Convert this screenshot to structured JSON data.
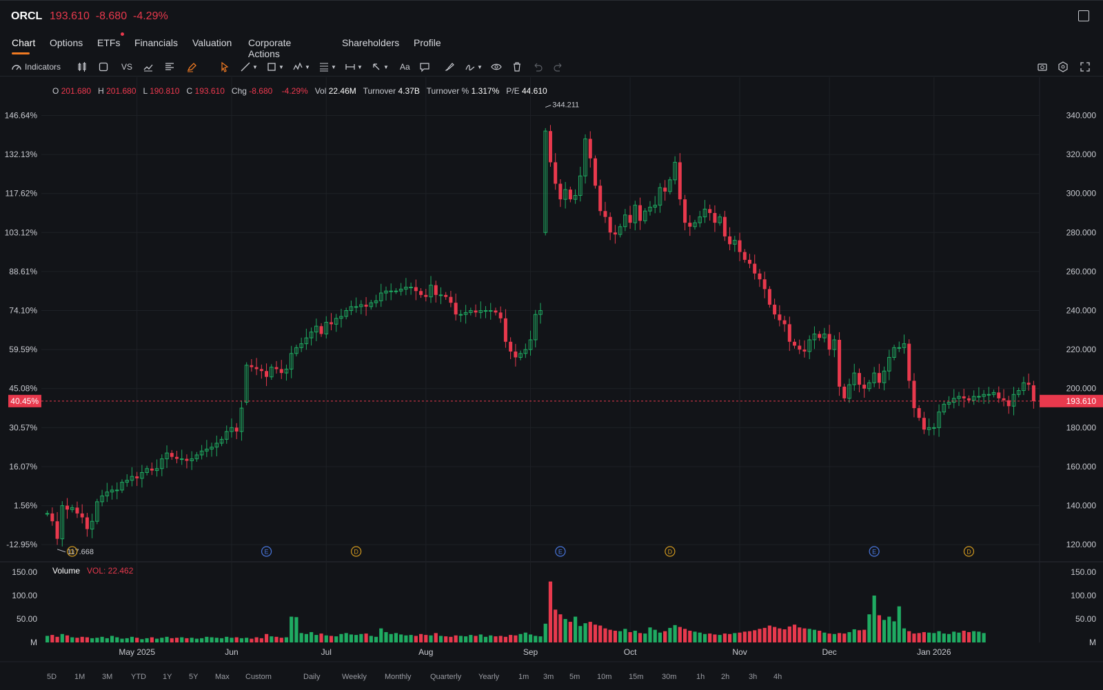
{
  "header": {
    "symbol": "ORCL",
    "price": "193.610",
    "change": "-8.680",
    "change_pct": "-4.29%"
  },
  "tabs": [
    "Chart",
    "Options",
    "ETFs",
    "Financials",
    "Valuation",
    "Corporate Actions",
    "Shareholders",
    "Profile"
  ],
  "toolbar": {
    "indicators_label": "Indicators",
    "vs_label": "VS",
    "text_label": "Aa"
  },
  "ohlc": {
    "o_label": "O",
    "o": "201.680",
    "h_label": "H",
    "h": "201.680",
    "l_label": "L",
    "l": "190.810",
    "c_label": "C",
    "c": "193.610",
    "chg_label": "Chg",
    "chg": "-8.680",
    "chg_pct": "-4.29%",
    "vol_label": "Vol",
    "vol": "22.46M",
    "turnover_label": "Turnover",
    "turnover": "4.37B",
    "turnover_pct_label": "Turnover %",
    "turnover_pct": "1.317%",
    "pe_label": "P/E",
    "pe": "44.610"
  },
  "colors": {
    "up": "#1fab62",
    "down": "#e8394d",
    "accent": "#f07a22"
  },
  "chart_data": {
    "type": "candlestick",
    "price_axis_labels": [
      "340.000",
      "320.000",
      "300.000",
      "280.000",
      "260.000",
      "240.000",
      "220.000",
      "200.000",
      "180.000",
      "160.000",
      "140.000",
      "120.000"
    ],
    "price_axis_values": [
      340,
      320,
      300,
      280,
      260,
      240,
      220,
      200,
      180,
      160,
      140,
      120
    ],
    "pct_axis_labels": [
      "146.64%",
      "132.13%",
      "117.62%",
      "103.12%",
      "88.61%",
      "74.10%",
      "59.59%",
      "45.08%",
      "30.57%",
      "16.07%",
      "1.56%",
      "-12.95%"
    ],
    "ylim": [
      113,
      349
    ],
    "current_price_label": "193.610",
    "current_pct_label": "40.45%",
    "current_price": 193.61,
    "max_label": "344.211",
    "max_value": 344.211,
    "min_label": "117.668",
    "min_value": 117.668,
    "x_labels": [
      "May 2025",
      "Jun",
      "Jul",
      "Aug",
      "Sep",
      "Oct",
      "Nov",
      "Dec",
      "Jan 2026"
    ],
    "x_label_index": [
      18,
      37,
      56,
      76,
      97,
      117,
      139,
      157,
      178
    ],
    "event_markers": [
      {
        "label": "D",
        "index": 5,
        "kind": "dividend"
      },
      {
        "label": "E",
        "index": 44,
        "kind": "earnings"
      },
      {
        "label": "D",
        "index": 62,
        "kind": "dividend"
      },
      {
        "label": "E",
        "index": 103,
        "kind": "earnings"
      },
      {
        "label": "D",
        "index": 125,
        "kind": "dividend"
      },
      {
        "label": "E",
        "index": 166,
        "kind": "earnings"
      },
      {
        "label": "D",
        "index": 185,
        "kind": "dividend"
      }
    ],
    "closes": [
      136,
      132,
      123,
      140,
      138,
      139,
      136,
      134,
      128,
      132,
      142,
      145,
      147,
      148,
      148,
      152,
      153,
      155,
      154,
      157,
      159,
      158,
      159,
      164,
      167,
      165,
      164,
      164,
      163,
      164,
      166,
      168,
      169,
      170,
      172,
      174,
      178,
      180,
      178,
      190,
      212,
      211,
      210,
      209,
      206,
      211,
      210,
      208,
      210,
      218,
      221,
      223,
      226,
      229,
      232,
      228,
      234,
      233,
      236,
      237,
      240,
      242,
      242,
      243,
      242,
      244,
      245,
      249,
      250,
      250,
      250,
      251,
      252,
      252,
      250,
      248,
      247,
      253,
      248,
      248,
      247,
      244,
      238,
      238,
      239,
      240,
      239,
      240,
      240,
      240,
      239,
      236,
      224,
      219,
      216,
      218,
      220,
      225,
      238,
      240,
      332,
      316,
      305,
      297,
      302,
      297,
      299,
      309,
      328,
      318,
      304,
      291,
      288,
      280,
      279,
      283,
      289,
      285,
      294,
      286,
      291,
      293,
      294,
      303,
      301,
      307,
      316,
      297,
      285,
      283,
      285,
      288,
      292,
      290,
      285,
      288,
      278,
      274,
      276,
      270,
      266,
      264,
      259,
      256,
      251,
      243,
      238,
      235,
      233,
      224,
      222,
      220,
      219,
      225,
      228,
      226,
      228,
      220,
      225,
      201,
      195,
      202,
      208,
      202,
      200,
      203,
      208,
      203,
      209,
      216,
      221,
      221,
      223,
      204,
      190,
      185,
      179,
      180,
      180,
      188,
      192,
      193,
      195,
      196,
      195,
      194,
      196,
      196,
      197,
      197,
      198,
      195,
      194,
      191,
      197,
      199,
      203,
      202,
      193.61
    ],
    "opens": [
      136,
      136,
      132,
      123,
      140,
      138,
      139,
      136,
      134,
      128,
      132,
      142,
      145,
      147,
      148,
      148,
      152,
      153,
      155,
      154,
      157,
      159,
      158,
      159,
      164,
      167,
      165,
      164,
      164,
      163,
      164,
      166,
      168,
      169,
      170,
      172,
      174,
      178,
      180,
      178,
      193,
      212,
      211,
      210,
      209,
      206,
      211,
      210,
      208,
      210,
      218,
      221,
      223,
      226,
      229,
      232,
      228,
      234,
      233,
      236,
      237,
      240,
      242,
      242,
      243,
      242,
      244,
      245,
      249,
      250,
      250,
      250,
      251,
      252,
      252,
      250,
      248,
      247,
      253,
      248,
      248,
      247,
      244,
      238,
      238,
      239,
      240,
      239,
      240,
      240,
      240,
      239,
      236,
      224,
      219,
      216,
      218,
      220,
      225,
      238,
      280,
      332,
      316,
      305,
      297,
      302,
      297,
      299,
      309,
      328,
      318,
      304,
      291,
      288,
      280,
      279,
      283,
      289,
      285,
      294,
      286,
      291,
      293,
      294,
      303,
      301,
      307,
      316,
      297,
      285,
      283,
      285,
      288,
      292,
      290,
      285,
      288,
      278,
      274,
      276,
      270,
      266,
      264,
      259,
      256,
      251,
      243,
      238,
      235,
      233,
      224,
      222,
      220,
      219,
      225,
      228,
      226,
      228,
      220,
      225,
      201,
      195,
      202,
      208,
      202,
      200,
      203,
      208,
      203,
      209,
      216,
      221,
      221,
      223,
      204,
      190,
      185,
      179,
      180,
      180,
      188,
      192,
      193,
      195,
      196,
      195,
      194,
      196,
      196,
      197,
      197,
      198,
      195,
      194,
      191,
      197,
      199,
      203,
      201.68
    ],
    "volume_axis_labels": [
      "150.00",
      "100.00",
      "50.00",
      "M"
    ],
    "volume_axis_values": [
      150,
      100,
      50,
      0
    ],
    "volume_ylim": [
      0,
      150
    ],
    "volume_label": "Volume",
    "volume_value_label": "VOL: 22.462",
    "volumes": [
      14,
      16,
      12,
      18,
      15,
      11,
      10,
      12,
      11,
      9,
      10,
      12,
      9,
      14,
      11,
      8,
      9,
      12,
      10,
      7,
      9,
      11,
      8,
      10,
      12,
      9,
      10,
      11,
      9,
      10,
      8,
      9,
      12,
      11,
      10,
      9,
      12,
      10,
      11,
      9,
      10,
      8,
      11,
      9,
      18,
      13,
      12,
      10,
      11,
      55,
      54,
      20,
      18,
      22,
      16,
      19,
      15,
      14,
      13,
      18,
      20,
      17,
      16,
      18,
      19,
      14,
      12,
      30,
      22,
      18,
      20,
      17,
      15,
      16,
      14,
      18,
      16,
      15,
      20,
      14,
      13,
      12,
      15,
      14,
      13,
      16,
      14,
      17,
      12,
      15,
      13,
      14,
      12,
      16,
      15,
      18,
      21,
      17,
      14,
      13,
      40,
      130,
      70,
      60,
      50,
      44,
      55,
      35,
      41,
      44,
      38,
      36,
      30,
      27,
      25,
      24,
      29,
      22,
      25,
      20,
      19,
      32,
      27,
      21,
      24,
      31,
      37,
      33,
      29,
      25,
      23,
      21,
      18,
      19,
      17,
      16,
      19,
      18,
      20,
      21,
      23,
      24,
      26,
      29,
      31,
      36,
      33,
      30,
      28,
      34,
      38,
      32,
      30,
      29,
      27,
      25,
      21,
      19,
      18,
      20,
      19,
      22,
      28,
      26,
      27,
      60,
      100,
      58,
      48,
      55,
      45,
      77,
      30,
      24,
      19,
      20,
      22,
      21,
      20,
      24,
      19,
      18,
      23,
      21,
      25,
      22,
      24,
      23,
      20
    ],
    "grid": true
  },
  "bottom_bar": [
    "5D",
    "1M",
    "3M",
    "YTD",
    "1Y",
    "5Y",
    "Max",
    "Custom",
    "Daily",
    "Weekly",
    "Monthly",
    "Quarterly",
    "Yearly",
    "1m",
    "3m",
    "5m",
    "10m",
    "15m",
    "30m",
    "1h",
    "2h",
    "3h",
    "4h"
  ]
}
